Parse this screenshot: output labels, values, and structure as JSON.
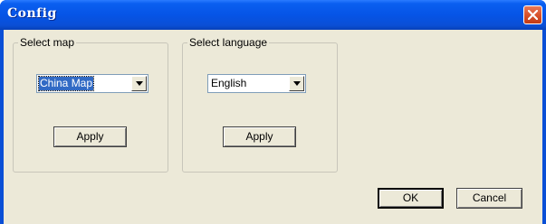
{
  "window": {
    "title": "Config"
  },
  "map_group": {
    "legend": "Select map",
    "selected": "China Map",
    "apply_label": "Apply"
  },
  "language_group": {
    "legend": "Select language",
    "selected": "English",
    "apply_label": "Apply"
  },
  "footer": {
    "ok_label": "OK",
    "cancel_label": "Cancel"
  },
  "colors": {
    "titlebar": "#0a4fd6",
    "client": "#ece9d8",
    "close_button": "#d9522b",
    "selection": "#316ac5"
  },
  "icons": [
    "close-icon",
    "dropdown-arrow-icon"
  ]
}
